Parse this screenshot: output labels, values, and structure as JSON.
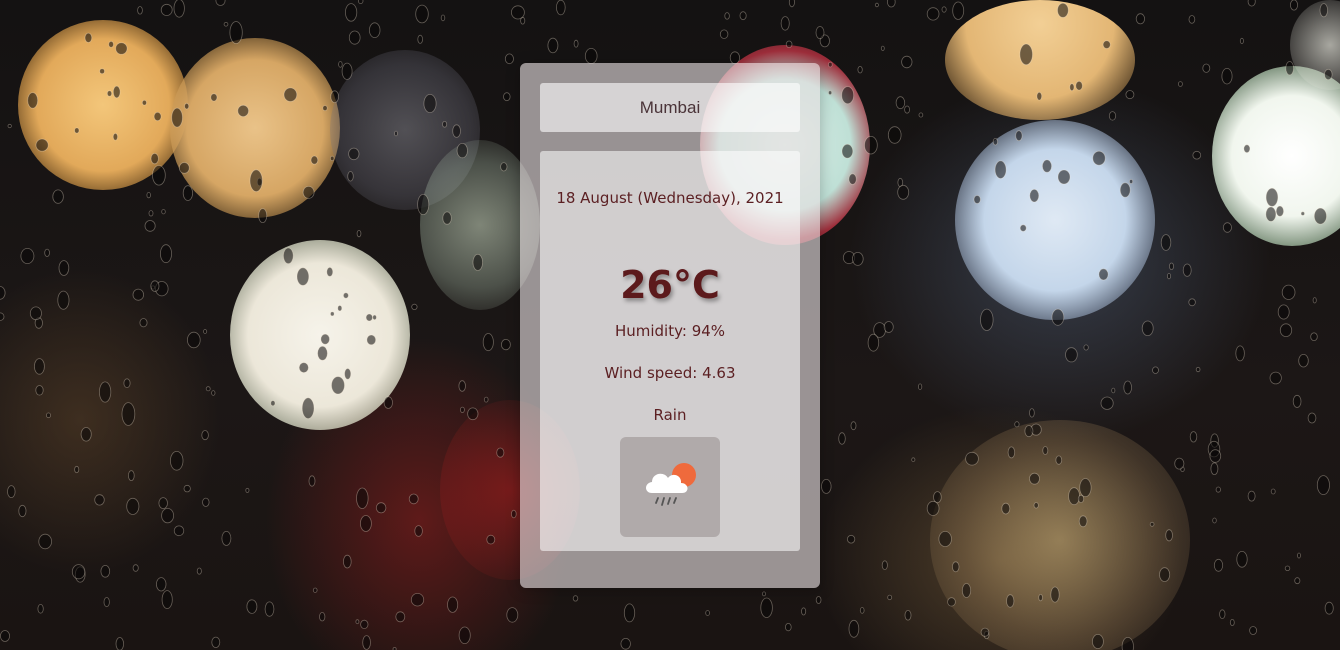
{
  "search": {
    "value": "Mumbai"
  },
  "weather": {
    "date": "18 August (Wednesday), 2021",
    "temperature": "26°C",
    "humidity": "Humidity: 94%",
    "wind": "Wind speed: 4.63",
    "description": "Rain",
    "icon": "cloud-rain-sun-icon"
  },
  "colors": {
    "text": "#5b1f22",
    "sun": "#ef6a3c"
  }
}
